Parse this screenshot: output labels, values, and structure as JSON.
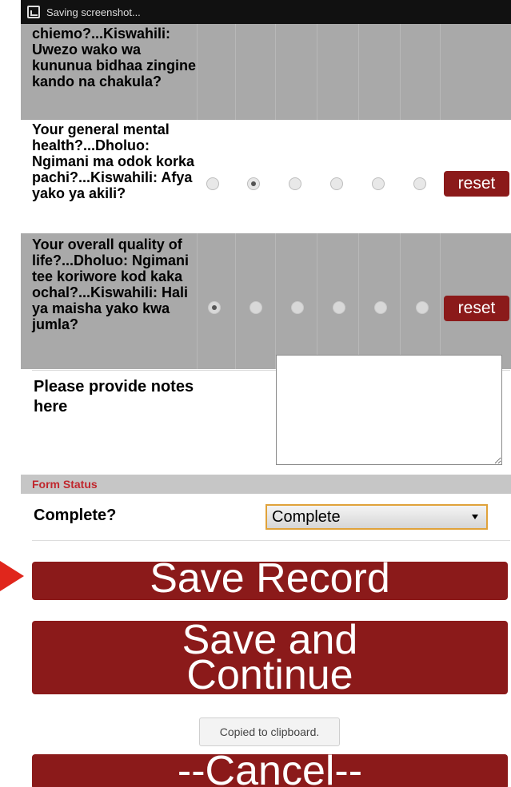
{
  "statusbar": {
    "text": "Saving screenshot...",
    "icon": "screenshot-icon"
  },
  "questions": [
    {
      "text": "chiemo?...Kiswahili: Uwezo wako wa kununua bidhaa zingine kando na chakula?",
      "background": "#a9a9a9",
      "selected_index": null,
      "show_radios": false,
      "reset_label": ""
    },
    {
      "text": "Your general mental health?...Dholuo: Ngimani ma odok korka pachi?...Kiswahili: Afya yako ya akili?",
      "background": "#ffffff",
      "selected_index": 1,
      "show_radios": true,
      "reset_label": "reset"
    },
    {
      "text": "Your overall quality of life?...Dholuo: Ngimani tee koriwore kod kaka ochal?...Kiswahili: Hali ya maisha yako kwa jumla?",
      "background": "#a9a9a9",
      "selected_index": 0,
      "show_radios": true,
      "reset_label": "reset"
    }
  ],
  "notes": {
    "label": "Please provide notes here",
    "value": ""
  },
  "form_status": {
    "section_title": "Form Status",
    "complete_label": "Complete?",
    "selected_option": "Complete"
  },
  "buttons": {
    "save_record": "Save Record",
    "save_continue_line1": "Save and",
    "save_continue_line2": "Continue",
    "cancel": "--Cancel--"
  },
  "toast": "Copied to clipboard.",
  "colors": {
    "brand": "#8b1a1a",
    "section_text": "#c0272d",
    "row_gray": "#a9a9a9",
    "select_border": "#e0a23a",
    "arrow": "#e0261c"
  }
}
